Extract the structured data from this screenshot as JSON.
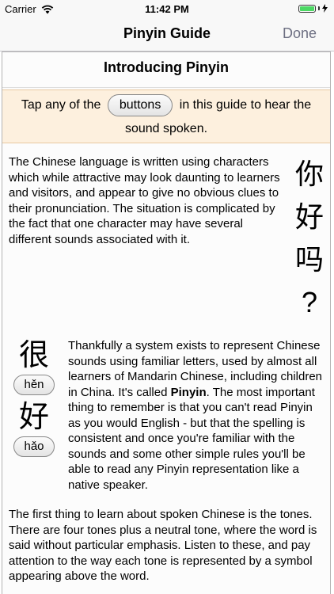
{
  "status": {
    "carrier": "Carrier",
    "time": "11:42 PM"
  },
  "nav": {
    "title": "Pinyin Guide",
    "done": "Done"
  },
  "heading": "Introducing Pinyin",
  "tip": {
    "before": "Tap any of the",
    "button": "buttons",
    "after": "in this guide to hear the sound spoken."
  },
  "intro": {
    "text": "The Chinese language is written using characters which while attractive may look daunting to learners and visitors, and appear to give no obvious clues to their pronunciation. The situation is complicated by the fact that one character may have several different sounds associated with it.",
    "chars": [
      "你",
      "好",
      "吗",
      "?"
    ]
  },
  "pinyin_section": {
    "examples": [
      {
        "char": "很",
        "pinyin": "hěn"
      },
      {
        "char": "好",
        "pinyin": "hǎo"
      }
    ],
    "text_before": "Thankfully a system exists to represent Chinese sounds using familiar letters, used by almost all learners of Mandarin Chinese, including children in China. It's called ",
    "bold": "Pinyin",
    "text_after": ". The most important thing to remember is that you can't read Pinyin as you would English - but that the spelling is consistent and once you're familiar with the sounds and some other simple rules you'll be able to read any Pinyin representation like a native speaker."
  },
  "tones": {
    "text": "The first thing to learn about spoken Chinese is the tones. There are four tones plus a neutral tone, where the word is said without particular emphasis. Listen to these, and pay attention to the way each tone is represented by a symbol appearing above the word."
  },
  "colors": {
    "accent": "#6d6f82",
    "tip_bg": "#fdf0de",
    "battery": "#4cd964"
  }
}
